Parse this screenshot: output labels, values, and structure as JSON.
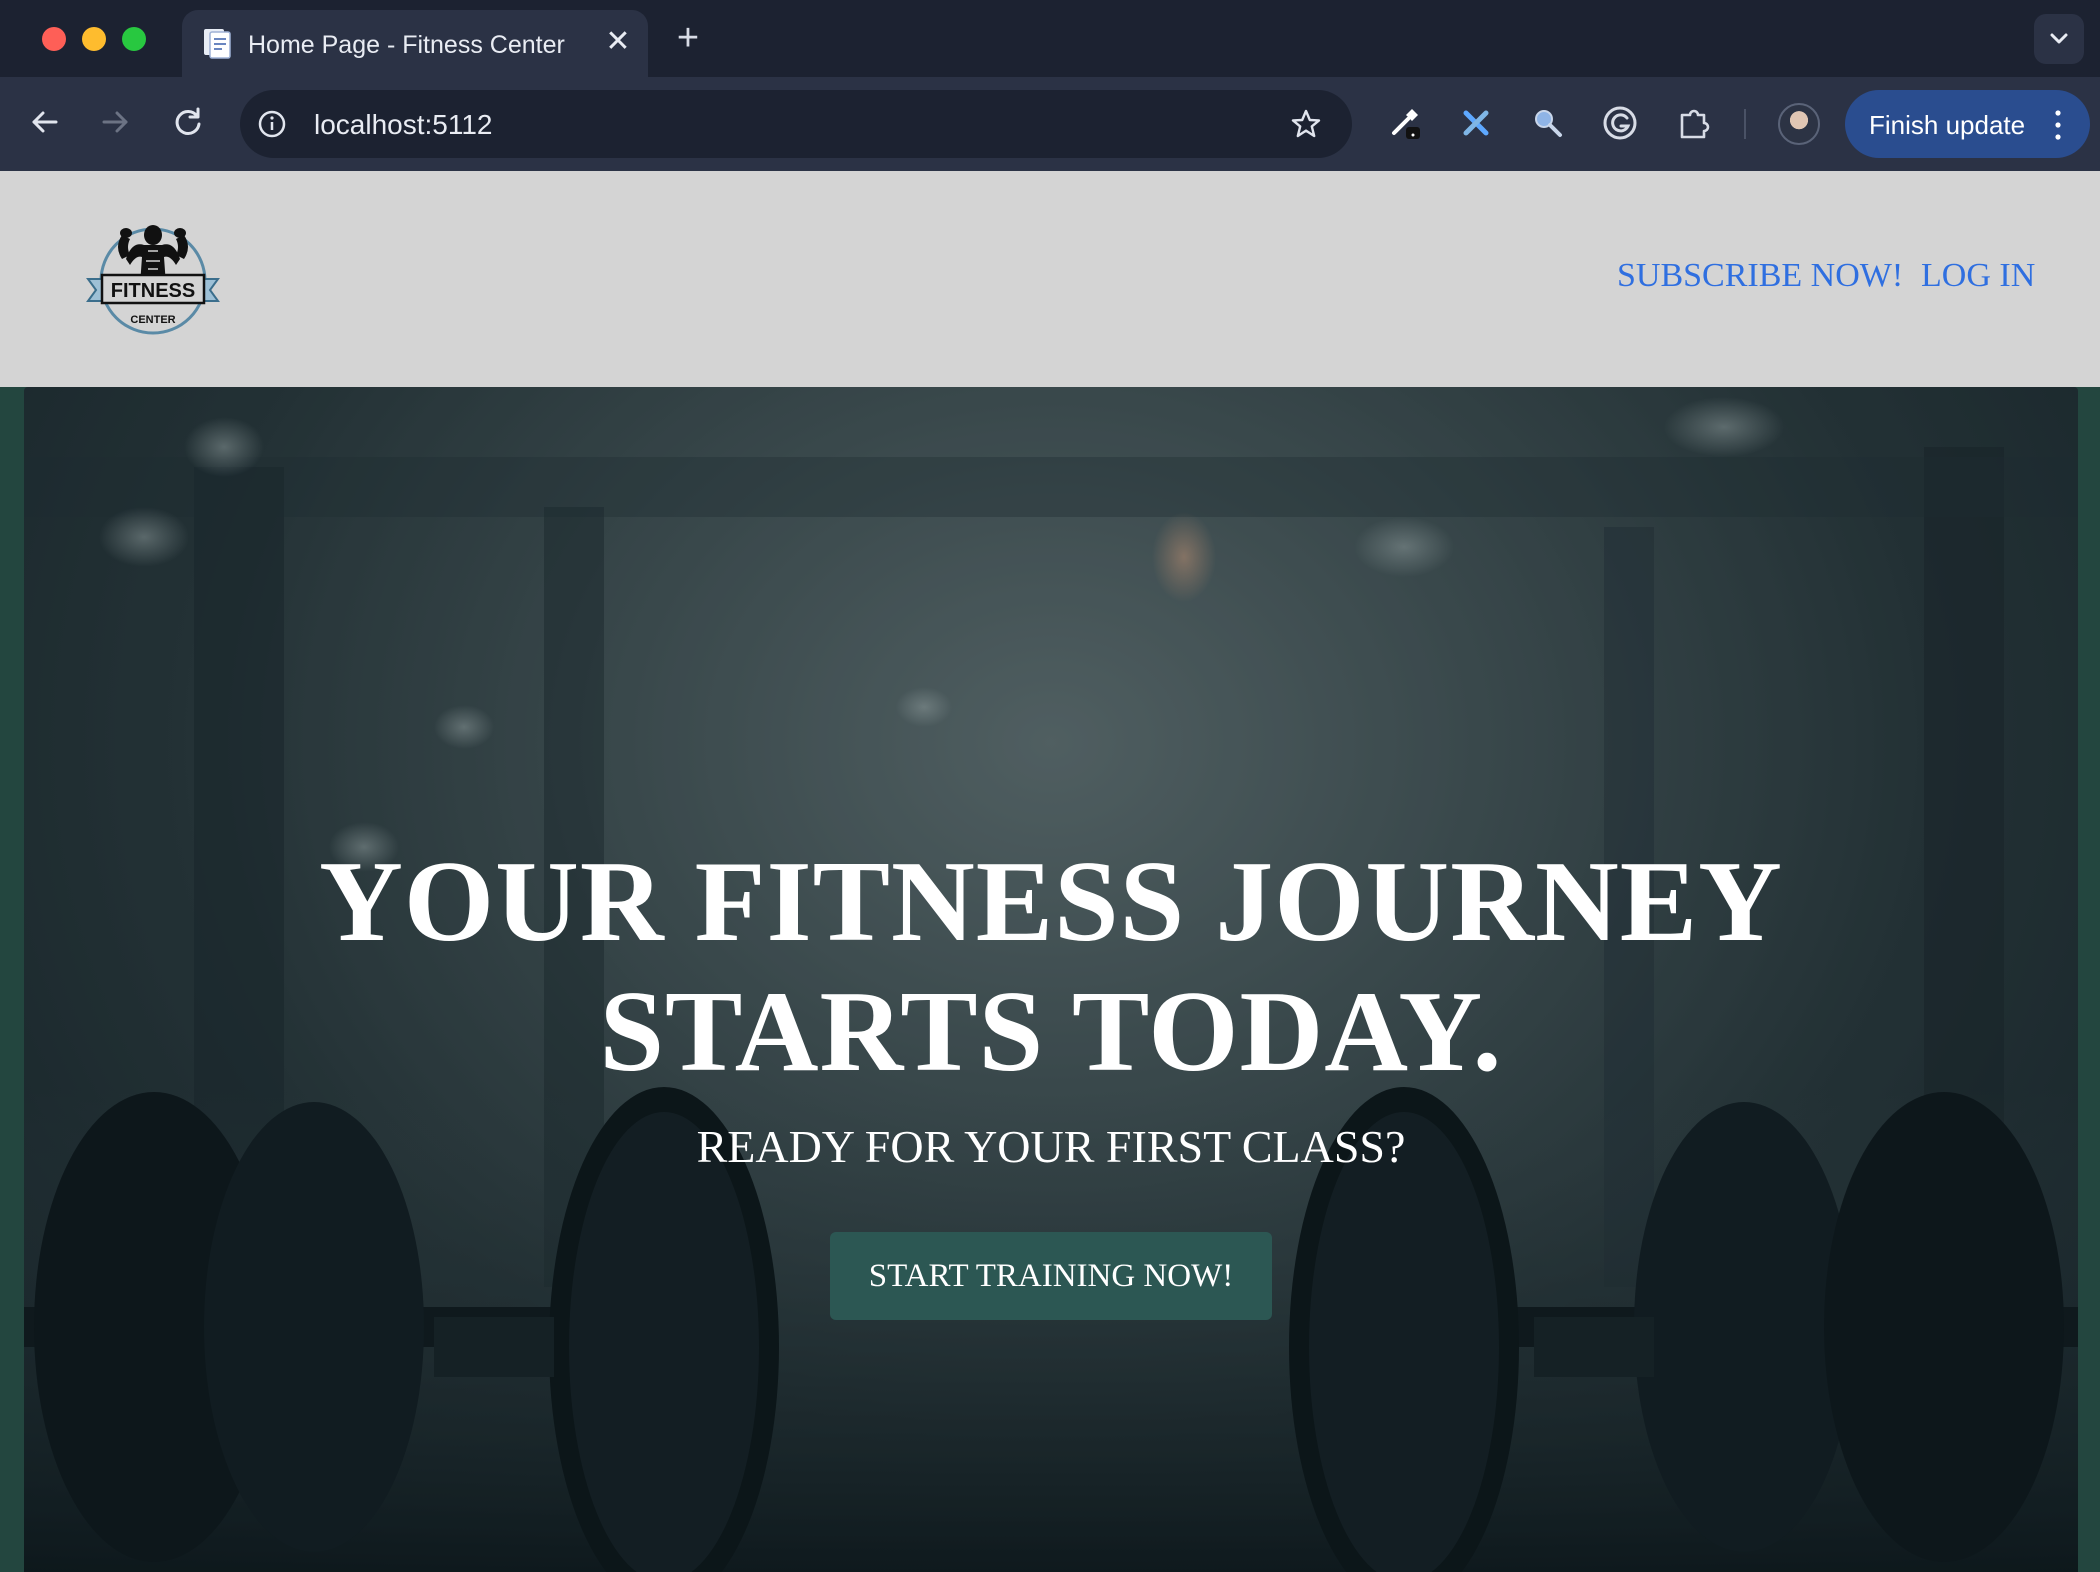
{
  "browser": {
    "tab": {
      "title": "Home Page - Fitness Center",
      "favicon": "document-icon"
    },
    "address_bar": {
      "url": "localhost:5112"
    },
    "update_button": {
      "label": "Finish update"
    },
    "extensions": [
      "eyedropper-icon",
      "tools-icon",
      "search-extension-icon",
      "grammarly-icon",
      "puzzle-icon"
    ]
  },
  "site": {
    "logo": {
      "line1": "FITNESS",
      "line2": "CENTER"
    },
    "nav": {
      "subscribe": "SUBSCRIBE NOW!",
      "login": "LOG IN"
    },
    "hero": {
      "title_line1": "YOUR FITNESS JOURNEY",
      "title_line2": "STARTS TODAY.",
      "subtitle": "READY FOR YOUR FIRST CLASS?",
      "cta": "START TRAINING NOW!"
    }
  },
  "colors": {
    "header_bg": "#d4d4d4",
    "nav_link": "#2f6fe0",
    "cta_bg": "#2c5753",
    "page_border": "#23463f"
  }
}
